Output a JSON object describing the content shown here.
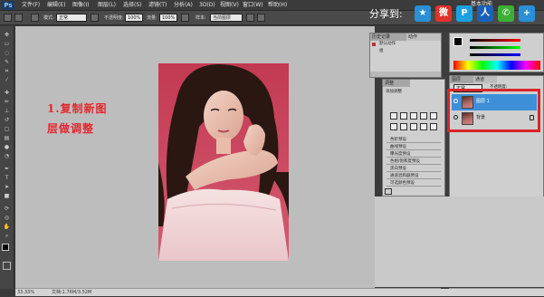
{
  "menubar": {
    "logo": "Ps",
    "items": [
      "文件(F)",
      "编辑(E)",
      "图像(I)",
      "图层(L)",
      "选择(S)",
      "滤镜(T)",
      "分析(A)",
      "3D(D)",
      "视图(V)",
      "窗口(W)",
      "帮助(H)"
    ],
    "workspace": "基本功能"
  },
  "optbar": {
    "mode_label": "模式:",
    "mode_value": "正常",
    "opacity_label": "不透明度:",
    "opacity_value": "100%",
    "flow_label": "流量:",
    "flow_value": "100%",
    "sample_label": "样本:",
    "sample_value": "当前图层"
  },
  "share": {
    "label": "分享到:",
    "buttons": [
      {
        "name": "qzone",
        "glyph": "★",
        "color": "#2a8fd6"
      },
      {
        "name": "weibo",
        "glyph": "微",
        "color": "#e0332b"
      },
      {
        "name": "tqq",
        "glyph": "P",
        "color": "#1aa2e0"
      },
      {
        "name": "renren",
        "glyph": "人",
        "color": "#1a61b8"
      },
      {
        "name": "wechat",
        "glyph": "✆",
        "color": "#3cb034"
      },
      {
        "name": "more",
        "glyph": "+",
        "color": "#2a8fd6"
      }
    ]
  },
  "canvas": {
    "annotation_line1": "1.复制新图",
    "annotation_line2": "层做调整",
    "status_zoom": "33.33%",
    "status_doc": "文档:1.76M/3.52M"
  },
  "history": {
    "tab1": "历史记录",
    "tab2": "动作",
    "item1": "默认动作",
    "item2": "组"
  },
  "adjust": {
    "tab": "调整",
    "title": "添加调整",
    "presets": [
      "色阶预设",
      "曲线预设",
      "曝光度预设",
      "色相/饱和度预设",
      "黑白预设",
      "通道混和器预设",
      "可选颜色预设"
    ]
  },
  "layers": {
    "tab1": "图层",
    "tab2": "通道",
    "blend_value": "正常",
    "opacity_label": "不透明度:",
    "layer1_name": "图层 1",
    "layer2_name": "背景"
  },
  "colors": {
    "accent_red": "#e3282e",
    "selected_layer": "#3d8fd8",
    "highlight_box": "#d8252a"
  }
}
